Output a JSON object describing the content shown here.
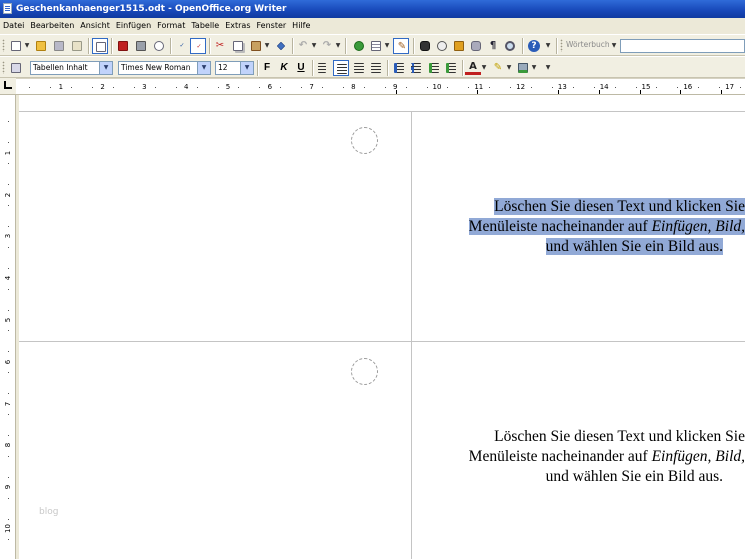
{
  "window": {
    "title": "Geschenkanhaenger1515.odt - OpenOffice.org Writer"
  },
  "menu": [
    "Datei",
    "Bearbeiten",
    "Ansicht",
    "Einfügen",
    "Format",
    "Tabelle",
    "Extras",
    "Fenster",
    "Hilfe"
  ],
  "toolbar_formatting": {
    "paragraph_style": "Tabellen Inhalt",
    "font_name": "Times New Roman",
    "font_size": "12",
    "bold_label": "F",
    "italic_label": "K",
    "underline_label": "U"
  },
  "toolbar_standard": {
    "dictionary_label": "Wörterbuch"
  },
  "ruler": {
    "horizontal_ticks": [
      "1",
      "2",
      "3",
      "4",
      "5",
      "6",
      "7",
      "8",
      "9",
      "10",
      "11",
      "12",
      "13",
      "14",
      "15",
      "16",
      "17"
    ],
    "vertical_ticks": [
      "1",
      "2",
      "3",
      "4",
      "5",
      "6",
      "7",
      "8",
      "9",
      "10"
    ]
  },
  "document": {
    "card_top": {
      "line1": "Löschen Sie diesen Text und klicken Sie",
      "line2_prefix": "Menüleiste nacheinander auf ",
      "line2_emphasis": "Einfügen, Bild,",
      "line3": "und wählen Sie ein Bild aus."
    },
    "card_bottom": {
      "line1": "Löschen Sie diesen Text und klicken Sie",
      "line2_prefix": "Menüleiste nacheinander auf ",
      "line2_emphasis": "Einfügen, Bild,",
      "line3": "und wählen Sie ein Bild aus."
    },
    "watermark": "blog",
    "selection_color": "#91a9d6"
  },
  "colors": {
    "titlebar": "#1747b8",
    "chrome": "#ece9d8",
    "accent": "#316ac5"
  }
}
